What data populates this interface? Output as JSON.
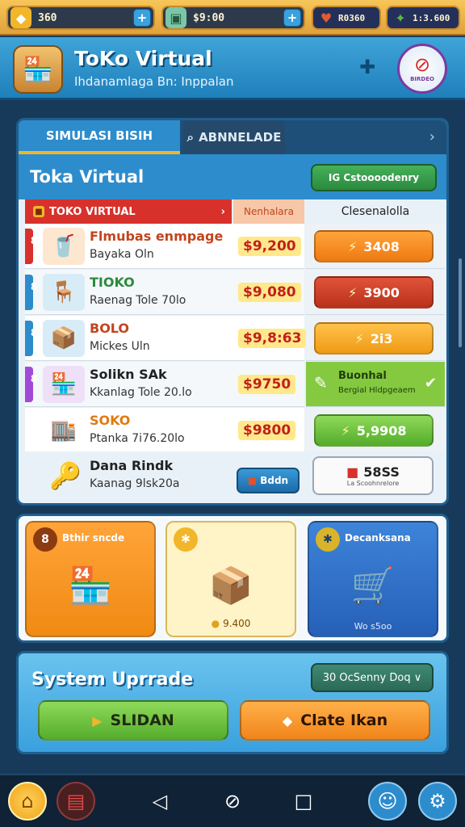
{
  "resources": [
    {
      "value": "360",
      "icon": "gold-coin-icon",
      "glyph": "◆"
    },
    {
      "value": "$9:00",
      "icon": "cash-icon",
      "glyph": "▣"
    },
    {
      "value": "R0360",
      "icon": "heart-gem-icon",
      "glyph": "♥"
    },
    {
      "value": "1:3.600",
      "icon": "green-cash-icon",
      "glyph": "✦"
    }
  ],
  "header": {
    "title": "ToKo Virtual",
    "subtitle": "Ihdanamlaga Bn: Inppalan",
    "emblem_label": "BIRDEO"
  },
  "tabs": [
    {
      "label": "SIMULASI BISIH"
    },
    {
      "label": "ABNNELADE"
    }
  ],
  "panel": {
    "title": "Toka Virtual",
    "action_label": "IG Cstoooodenry"
  },
  "table": {
    "headers": [
      "TOKO VIRTUAL",
      "Nenhalara",
      "Clesenalolla"
    ],
    "rows": [
      {
        "num": "8",
        "name": "Flmubas enmpage",
        "desc": "Bayaka Oln",
        "price": "$9,200",
        "action": "3408",
        "style": "b-orange",
        "marker": "#d8312c",
        "img": "🥤",
        "imgbg": "#fde7d0",
        "namecolor": "#c2451d"
      },
      {
        "num": "8",
        "name": "TIOKO",
        "desc": "Raenag Tole 70lo",
        "price": "$9,080",
        "action": "3900",
        "style": "b-red",
        "marker": "#2d8ccc",
        "img": "🪑",
        "imgbg": "#d8ecf8",
        "namecolor": "#2b8a3e"
      },
      {
        "num": "8",
        "name": "BOLO",
        "desc": "Mickes Uln",
        "price": "$9,8:63",
        "action": "2i3",
        "style": "b-yellow",
        "marker": "#2d8ccc",
        "img": "📦",
        "imgbg": "#d8ecf8",
        "namecolor": "#c2451d"
      },
      {
        "num": "8",
        "name": "Solikn SAk",
        "desc": "Kkanlag Tole 20.lo",
        "price": "$9750",
        "action": null,
        "marker": "#a24ad8",
        "img": "🏪",
        "imgbg": "#eee0f8",
        "namecolor": "#222"
      },
      {
        "num": "",
        "name": "SOKO",
        "desc": "Ptanka 7i76.20lo",
        "price": "$9800",
        "action": "5,9908",
        "style": "b-lime",
        "marker": "#ffffff",
        "img": "🏬",
        "imgbg": "#ffffff",
        "namecolor": "#e07a12"
      }
    ],
    "highlight": {
      "name": "Buonhal",
      "sub": "Bergial Hldpgeaem"
    },
    "last_row": {
      "name": "Dana Rindk",
      "desc": "Kaanag 9lsk20a",
      "small_button": "Bddn",
      "white_button": "58SS",
      "white_sub": "La Scoohnrelore"
    }
  },
  "cards": [
    {
      "num": "8",
      "title": "Bthir sncde",
      "art": "🏪"
    },
    {
      "num": "✱",
      "title": "",
      "art": "📦",
      "price": "9.400"
    },
    {
      "num": "✱",
      "title": "Decanksana",
      "art": "🛒",
      "sub": "Wo s5oo"
    }
  ],
  "upgrade": {
    "title": "System Uprrade",
    "pill": "30 OcSenny Doq ∨",
    "btn_left": "SLIDAN",
    "btn_right": "Clate Ikan"
  },
  "colors": {
    "brand": "#2d8ccc",
    "accent": "#f2b62b",
    "danger": "#d8312c",
    "success": "#55ad2b"
  }
}
